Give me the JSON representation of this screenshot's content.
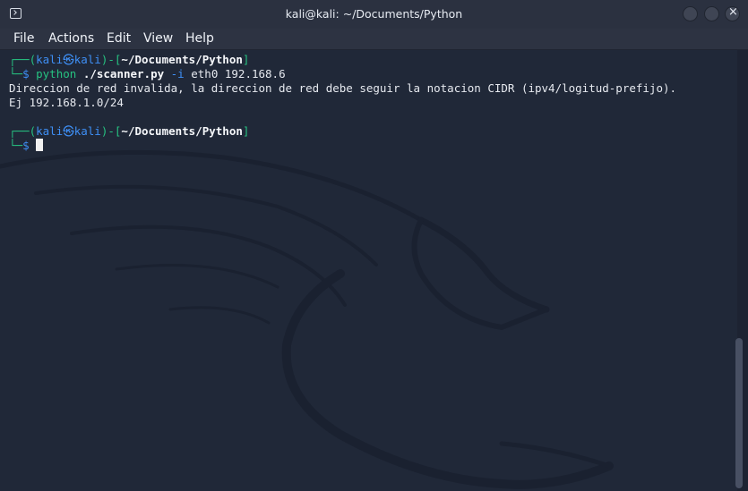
{
  "window": {
    "title": "kali@kali: ~/Documents/Python"
  },
  "menu": {
    "file": "File",
    "actions": "Actions",
    "edit": "Edit",
    "view": "View",
    "help": "Help"
  },
  "terminal": {
    "prompt1": {
      "open": "┌──(",
      "user": "kali",
      "at": "㉿",
      "host": "kali",
      "mid": ")-[",
      "path": "~/Documents/Python",
      "close": "]",
      "corner": "└─",
      "dollar": "$"
    },
    "command": {
      "program": "python",
      "script": "./scanner.py",
      "flag": "-i",
      "args": "eth0 192.168.6"
    },
    "output": [
      "Direccion de red invalida, la direccion de red debe seguir la notacion CIDR (ipv4/logitud-prefijo).",
      "Ej 192.168.1.0/24"
    ],
    "prompt2": {
      "open": "┌──(",
      "user": "kali",
      "at": "㉿",
      "host": "kali",
      "mid": ")-[",
      "path": "~/Documents/Python",
      "close": "]",
      "corner": "└─",
      "dollar": "$"
    }
  },
  "colors": {
    "background": "#202838",
    "prompt": "#26c281",
    "user": "#3e8ff5",
    "text": "#e6e9ef"
  }
}
